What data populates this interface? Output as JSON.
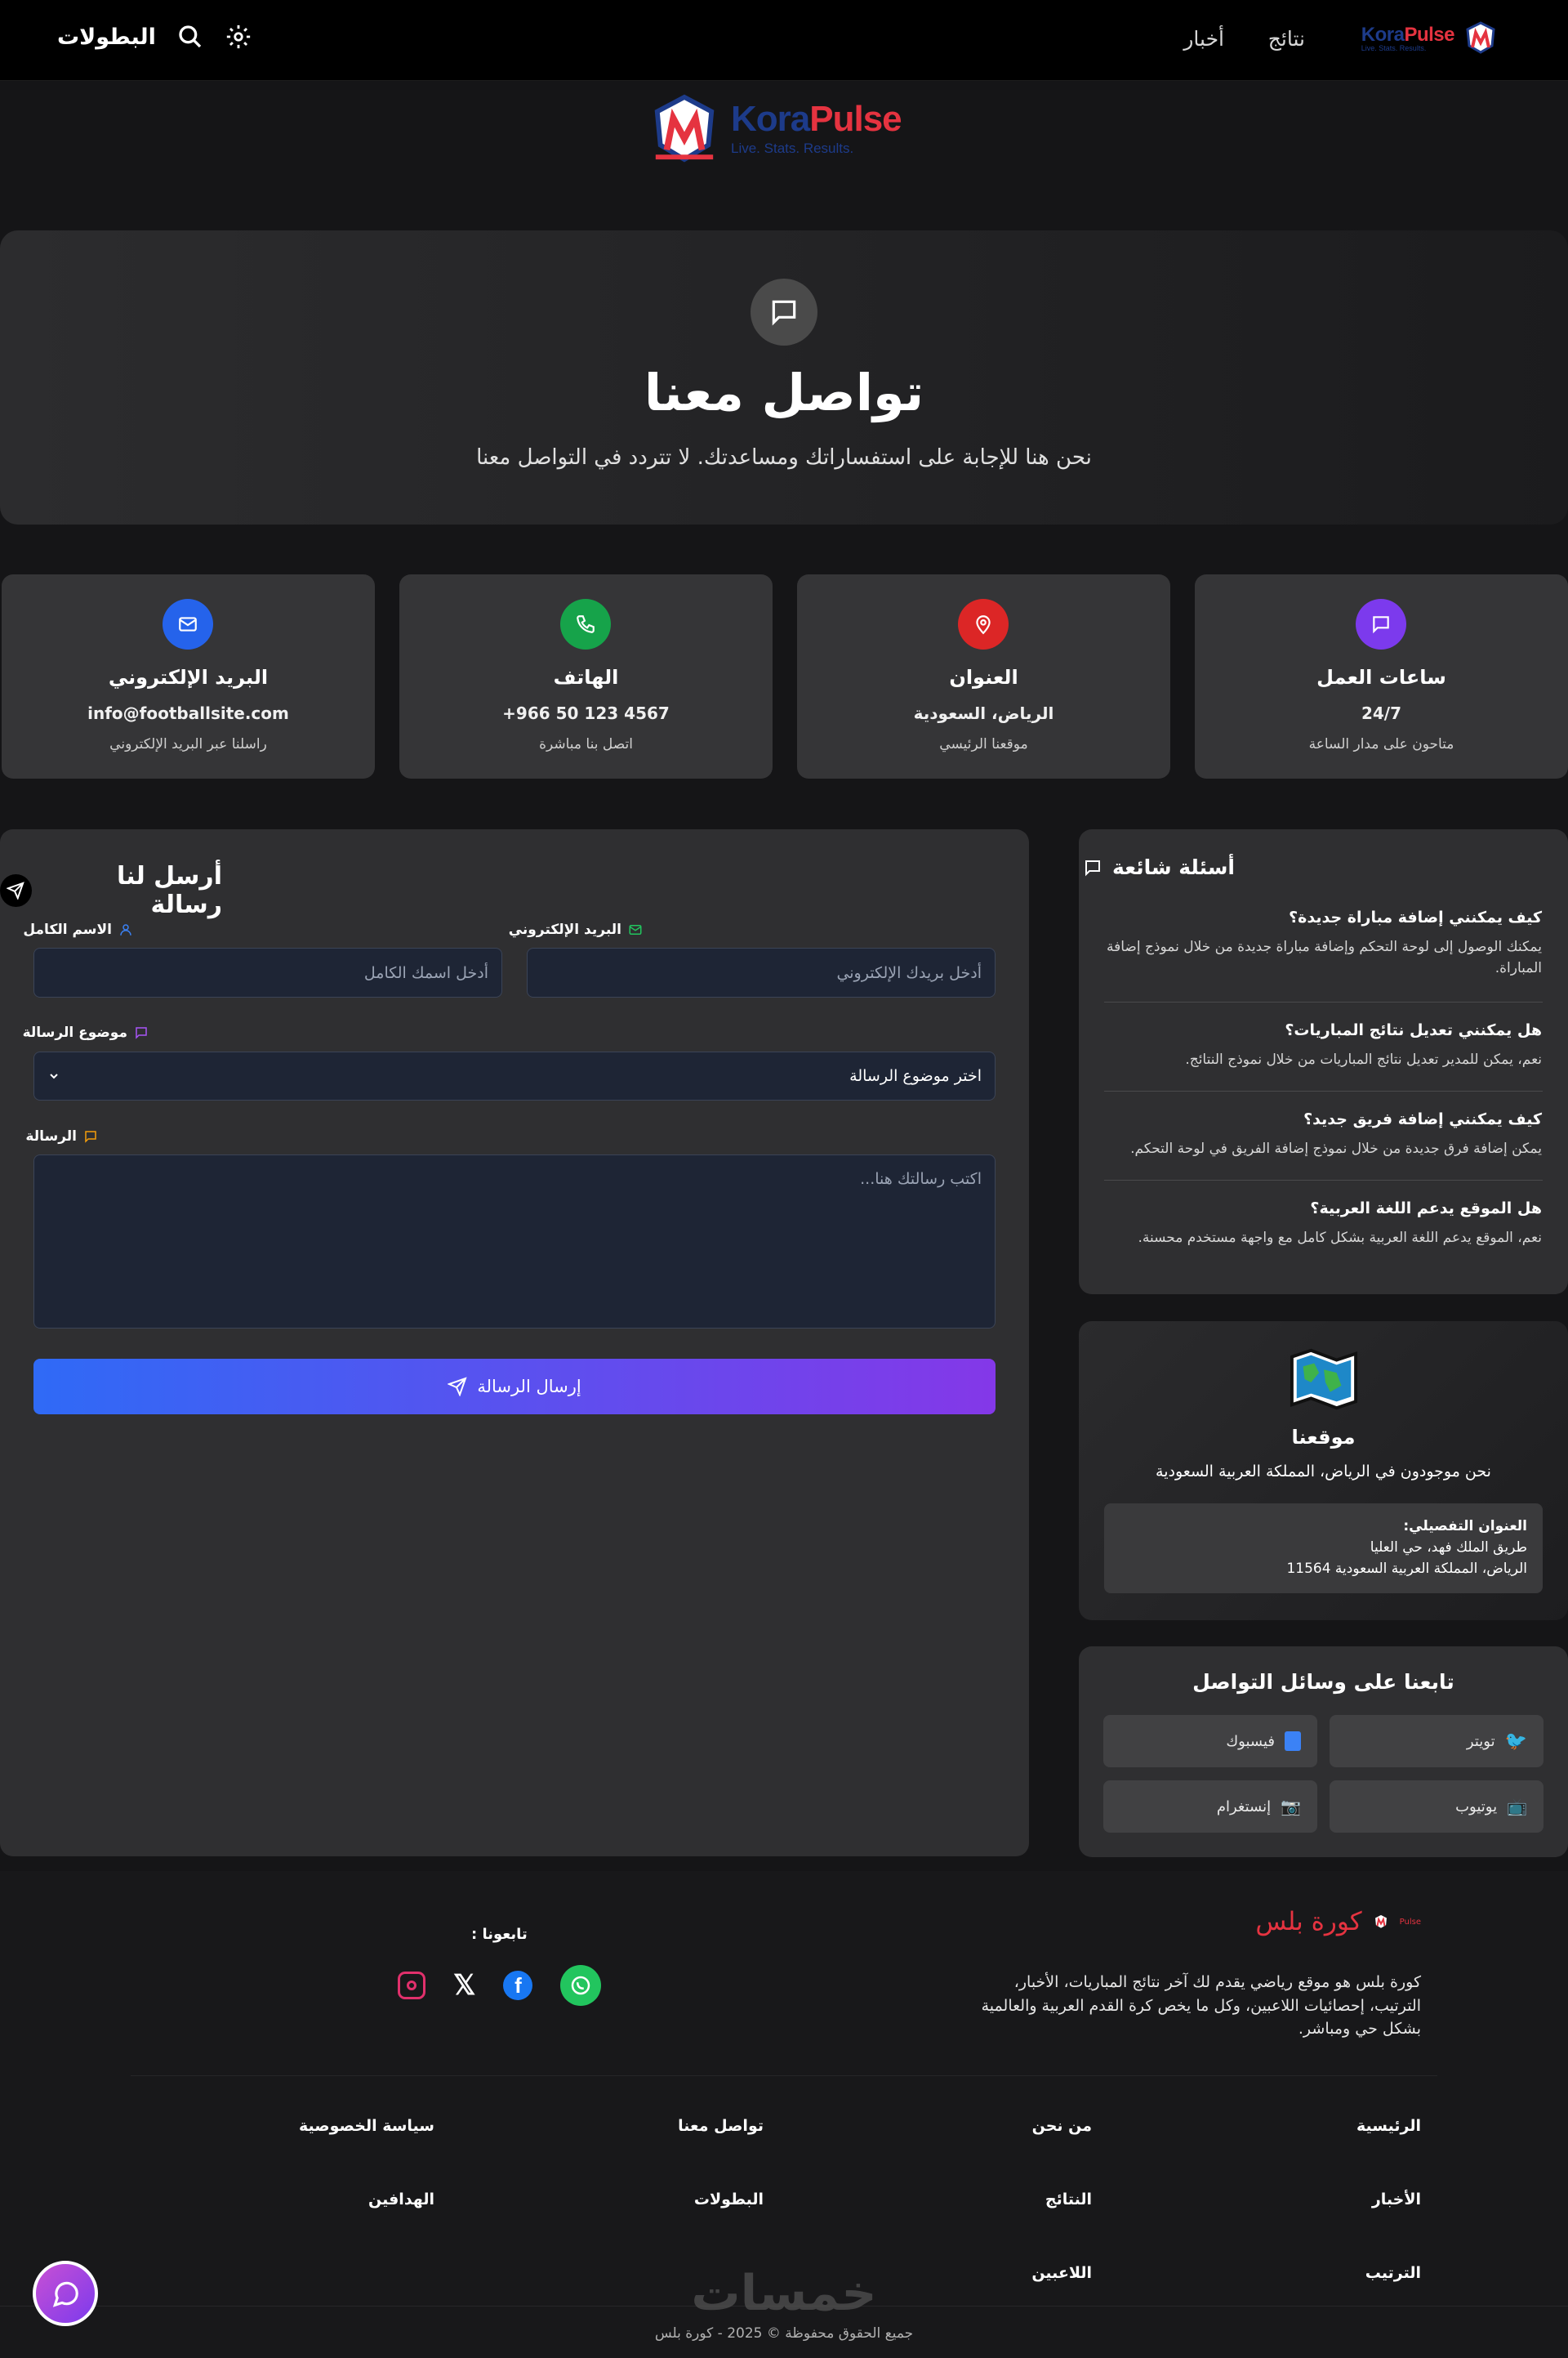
{
  "topbar": {
    "brand_k": "Kora",
    "brand_p": "Pulse",
    "brand_tagline": "Live. Stats. Results.",
    "nav": [
      "نتائج",
      "أخبار"
    ],
    "championships": "البطولات"
  },
  "logo": {
    "k": "Kora",
    "p": "Pulse",
    "tagline": "Live. Stats. Results."
  },
  "hero": {
    "title": "تواصل معنا",
    "subtitle": "نحن هنا للإجابة على استفساراتك ومساعدتك. لا تتردد في التواصل معنا"
  },
  "cards": [
    {
      "title": "ساعات العمل",
      "value": "24/7",
      "desc": "متاحون على مدار الساعة",
      "color": "#7c3aed",
      "icon": "chat-icon"
    },
    {
      "title": "العنوان",
      "value": "الرياض، السعودية",
      "desc": "موقعنا الرئيسي",
      "color": "#dc2626",
      "icon": "map-pin-icon"
    },
    {
      "title": "الهاتف",
      "value": "+966 50 123 4567",
      "desc": "اتصل بنا مباشرة",
      "color": "#16a34a",
      "icon": "phone-icon"
    },
    {
      "title": "البريد الإلكتروني",
      "value": "info@footballsite.com",
      "desc": "راسلنا عبر البريد الإلكتروني",
      "color": "#2563eb",
      "icon": "mail-icon"
    }
  ],
  "form": {
    "title": "أرسل لنا رسالة",
    "name_label": "الاسم الكامل",
    "name_placeholder": "أدخل اسمك الكامل",
    "email_label": "البريد الإلكتروني",
    "email_placeholder": "أدخل بريدك الإلكتروني",
    "subject_label": "موضوع الرسالة",
    "subject_value": "اختر موضوع الرسالة",
    "message_label": "الرسالة",
    "message_placeholder": "اكتب رسالتك هنا...",
    "send": "إرسال الرسالة"
  },
  "faq": {
    "title": "أسئلة شائعة",
    "items": [
      {
        "q": "كيف يمكنني إضافة مباراة جديدة؟",
        "a": "يمكنك الوصول إلى لوحة التحكم وإضافة مباراة جديدة من خلال نموذج إضافة المباراة."
      },
      {
        "q": "هل يمكنني تعديل نتائج المباريات؟",
        "a": "نعم، يمكن للمدير تعديل نتائج المباريات من خلال نموذج النتائج."
      },
      {
        "q": "كيف يمكنني إضافة فريق جديد؟",
        "a": "يمكن إضافة فرق جديدة من خلال نموذج إضافة الفريق في لوحة التحكم."
      },
      {
        "q": "هل الموقع يدعم اللغة العربية؟",
        "a": "نعم، الموقع يدعم اللغة العربية بشكل كامل مع واجهة مستخدم محسنة."
      }
    ]
  },
  "location": {
    "title": "موقعنا",
    "subtitle": "نحن موجودون في الرياض، المملكة العربية السعودية",
    "addr_label": "العنوان التفصيلي:",
    "addr_line1": "طريق الملك فهد، حي العليا",
    "addr_line2": "الرياض، المملكة العربية السعودية 11564"
  },
  "social": {
    "title": "تابعنا على وسائل التواصل",
    "items": [
      "تويتر",
      "فيسبوك",
      "يوتيوب",
      "إنستغرام"
    ]
  },
  "footer": {
    "brand": "كورة بلس",
    "mini": "Pulse",
    "about": [
      "كورة بلس هو موقع رياضي يقدم لك آخر نتائج المباريات، الأخبار،",
      "الترتيب، إحصائيات اللاعبين، وكل ما يخص كرة القدم العربية والعالمية",
      "بشكل حي ومباشر."
    ],
    "follow": "تابعونا :",
    "links": [
      [
        "الرئيسية",
        "من نحن",
        "تواصل معنا",
        "سياسة الخصوصية"
      ],
      [
        "الأخبار",
        "النتائج",
        "البطولات",
        "الهدافين"
      ],
      [
        "الترتيب",
        "اللاعبين"
      ]
    ],
    "watermark": "خمسات",
    "copyright": "جميع الحقوق محفوظة © 2025 - كورة بلس"
  }
}
